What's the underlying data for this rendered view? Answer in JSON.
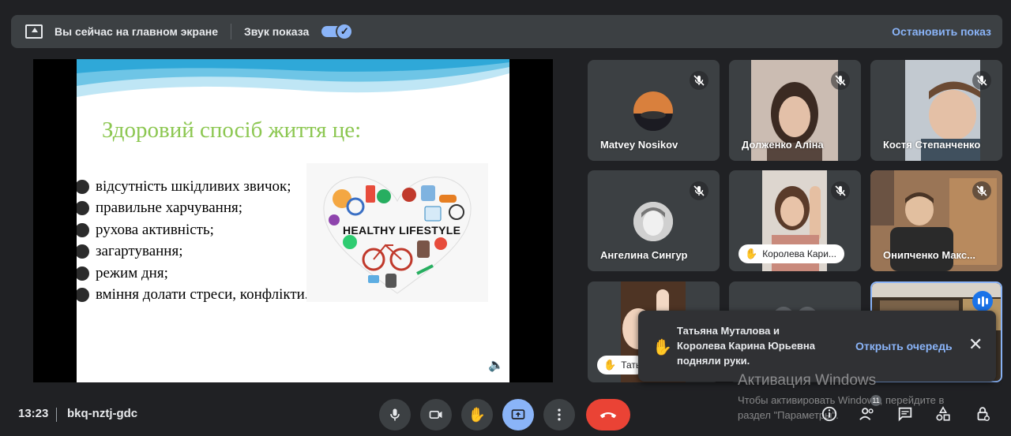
{
  "banner": {
    "message": "Вы сейчас на главном экране",
    "sound_label": "Звук показа",
    "sound_enabled": true,
    "stop_label": "Остановить показ"
  },
  "slide": {
    "title": "Здоровий спосіб життя це:",
    "bullets": [
      "відсутність шкідливих звичок;",
      "правильне харчування;",
      "рухова активність;",
      "загартування;",
      "режим дня;",
      "вміння долати стреси, конфлікти."
    ],
    "image_caption": "HEALTHY LIFESTYLE"
  },
  "participants": [
    {
      "name": "Matvey Nosikov",
      "muted": true
    },
    {
      "name": "Долженко Аліна",
      "muted": true
    },
    {
      "name": "Костя Степанченко",
      "muted": true
    },
    {
      "name": "Ангелина Сингур",
      "muted": true
    },
    {
      "name": "Королева Кари...",
      "muted": true,
      "hand_raised": true
    },
    {
      "name": "Онипченко Макс...",
      "muted": true
    },
    {
      "name": "Тать",
      "hand_raised": true
    },
    {
      "name": ""
    },
    {
      "name": "",
      "speaking": true
    }
  ],
  "notification": {
    "line1": "Татьяна Муталова и",
    "line2": "Королева Карина Юрьевна",
    "line3": "подняли руки.",
    "action": "Открыть очередь"
  },
  "watermark": {
    "title": "Активация Windows",
    "line1": "Чтобы активировать Windows, перейдите в",
    "line2": "раздел \"Параметры\"."
  },
  "bottom": {
    "time": "13:23",
    "meeting_code": "bkq-nztj-gdc",
    "participant_count": "11"
  },
  "colors": {
    "accent": "#8ab4f8",
    "end_call": "#ea4335",
    "slide_title": "#8cc751"
  }
}
